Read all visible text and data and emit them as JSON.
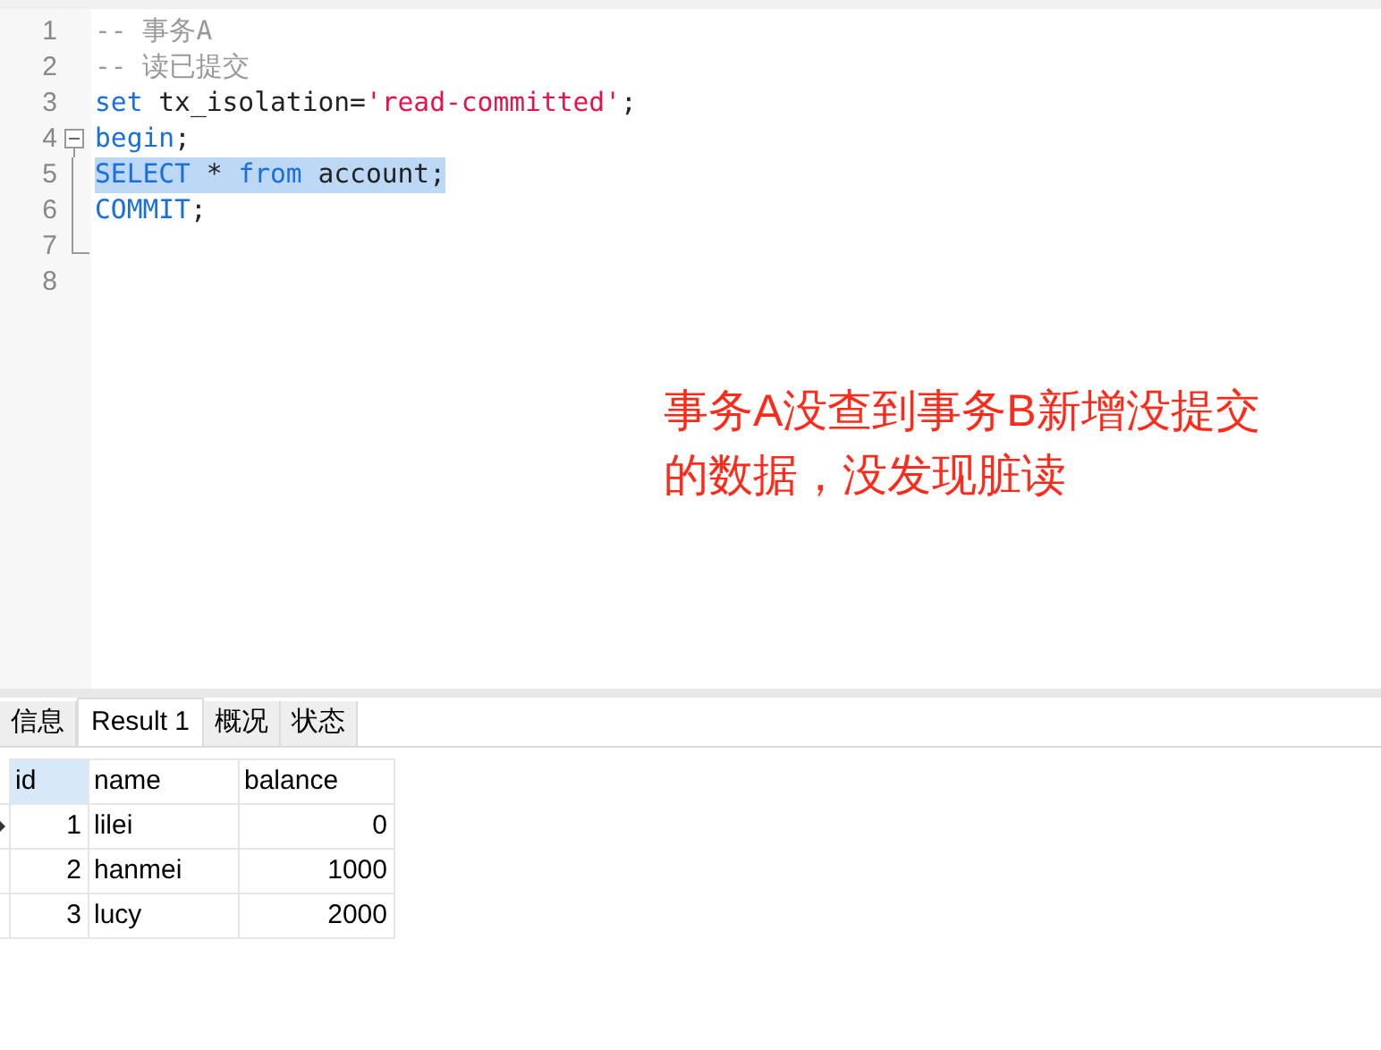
{
  "editor": {
    "lines": [
      {
        "number": "1",
        "selected": false,
        "kind": "plain",
        "tokens": [
          {
            "kind": "comment",
            "text": "-- 事务A"
          }
        ]
      },
      {
        "number": "2",
        "selected": false,
        "kind": "plain",
        "tokens": [
          {
            "kind": "comment",
            "text": "-- 读已提交"
          }
        ]
      },
      {
        "number": "3",
        "selected": false,
        "kind": "plain",
        "tokens": [
          {
            "kind": "keyword",
            "text": "set"
          },
          {
            "kind": "plain",
            "text": " tx_isolation="
          },
          {
            "kind": "string",
            "text": "'read-committed'"
          },
          {
            "kind": "plain",
            "text": ";"
          }
        ]
      },
      {
        "number": "4",
        "selected": false,
        "kind": "foldstart",
        "tokens": [
          {
            "kind": "keyword",
            "text": "begin"
          },
          {
            "kind": "plain",
            "text": ";"
          }
        ]
      },
      {
        "number": "5",
        "selected": true,
        "kind": "foldbody",
        "tokens": [
          {
            "kind": "keyword",
            "text": "SELECT"
          },
          {
            "kind": "plain",
            "text": " * "
          },
          {
            "kind": "keyword",
            "text": "from"
          },
          {
            "kind": "plain",
            "text": " account;"
          }
        ]
      },
      {
        "number": "6",
        "selected": false,
        "kind": "foldbody",
        "tokens": [
          {
            "kind": "keyword",
            "text": "COMMIT"
          },
          {
            "kind": "plain",
            "text": ";"
          }
        ]
      },
      {
        "number": "7",
        "selected": false,
        "kind": "foldend"
      },
      {
        "number": "8",
        "selected": false,
        "kind": "plain"
      }
    ]
  },
  "annotation": [
    "事务A没查到事务B新增没提交",
    "的数据，没发现脏读"
  ],
  "tabs": [
    {
      "label": "信息",
      "selected": false
    },
    {
      "label": "Result 1",
      "selected": true
    },
    {
      "label": "概况",
      "selected": false
    },
    {
      "label": "状态",
      "selected": false
    }
  ],
  "table": {
    "columns": [
      {
        "label": "id",
        "selected": true,
        "kind": "number"
      },
      {
        "label": "name",
        "selected": false,
        "kind": "text"
      },
      {
        "label": "balance",
        "selected": false,
        "kind": "number"
      }
    ],
    "rows": [
      {
        "current": true,
        "cells": [
          "1",
          "lilei",
          "0"
        ]
      },
      {
        "current": false,
        "cells": [
          "2",
          "hanmei",
          "1000"
        ]
      },
      {
        "current": false,
        "cells": [
          "3",
          "lucy",
          "2000"
        ]
      }
    ]
  }
}
